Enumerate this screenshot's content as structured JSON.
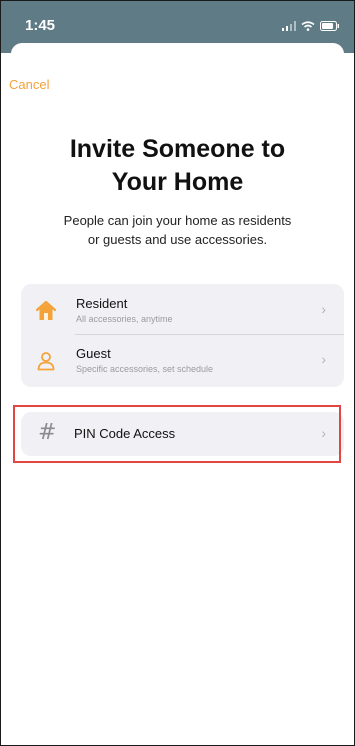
{
  "status_bar": {
    "time": "1:45",
    "icons": [
      "signal-icon",
      "wifi-icon",
      "battery-icon"
    ]
  },
  "nav": {
    "cancel_label": "Cancel"
  },
  "header": {
    "title_line1": "Invite Someone to",
    "title_line2": "Your Home",
    "subtitle_line1": "People can join your home as residents",
    "subtitle_line2": "or guests and use accessories."
  },
  "options": [
    {
      "label": "Resident",
      "description": "All accessories, anytime",
      "icon": "house-icon",
      "chevron": "›"
    },
    {
      "label": "Guest",
      "description": "Specific accessories, set schedule",
      "icon": "person-icon",
      "chevron": "›"
    }
  ],
  "pin_access": {
    "label": "PIN Code Access",
    "icon_glyph": "#",
    "chevron": "›"
  },
  "colors": {
    "status_bar_bg": "#5f7c86",
    "accent": "#f4a23a",
    "highlight_border": "#e34545",
    "group_bg": "#f1f1f5"
  }
}
